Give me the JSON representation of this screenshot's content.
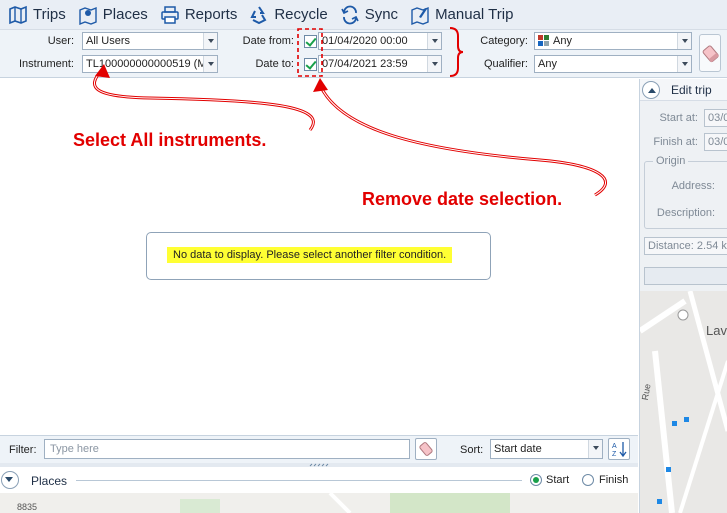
{
  "toolbar": {
    "trips": "Trips",
    "places": "Places",
    "reports": "Reports",
    "recycle": "Recycle",
    "sync": "Sync",
    "manual_trip": "Manual Trip"
  },
  "filters": {
    "user_label": "User:",
    "user_value": "All Users",
    "instrument_label": "Instrument:",
    "instrument_value": "TL100000000000519 (M",
    "date_from_label": "Date from:",
    "date_from_value": "01/04/2020 00:00",
    "date_to_label": "Date to:",
    "date_to_value": "07/04/2021 23:59",
    "category_label": "Category:",
    "category_value": "Any",
    "qualifier_label": "Qualifier:",
    "qualifier_value": "Any"
  },
  "main": {
    "no_data": "No data to display. Please select another filter condition."
  },
  "annotations": {
    "select_all": "Select  All instruments.",
    "remove_date": "Remove date selection."
  },
  "edit_panel": {
    "title": "Edit trip",
    "start_label": "Start at:",
    "start_value": "03/0",
    "finish_label": "Finish at:",
    "finish_value": "03/0",
    "origin_label": "Origin",
    "address_label": "Address:",
    "description_label": "Description:",
    "distance": "Distance: 2.54 k",
    "map_label": "Lav",
    "map_street": "Rue"
  },
  "bottom": {
    "filter_label": "Filter:",
    "filter_placeholder": "Type here",
    "sort_label": "Sort:",
    "sort_value": "Start date"
  },
  "places_bar": {
    "label": "Places",
    "start": "Start",
    "finish": "Finish"
  },
  "map_snippet": {
    "number": "8835"
  },
  "colors": {
    "annotation": "#e20000",
    "highlight": "#ffff33",
    "check": "#19a04a"
  }
}
